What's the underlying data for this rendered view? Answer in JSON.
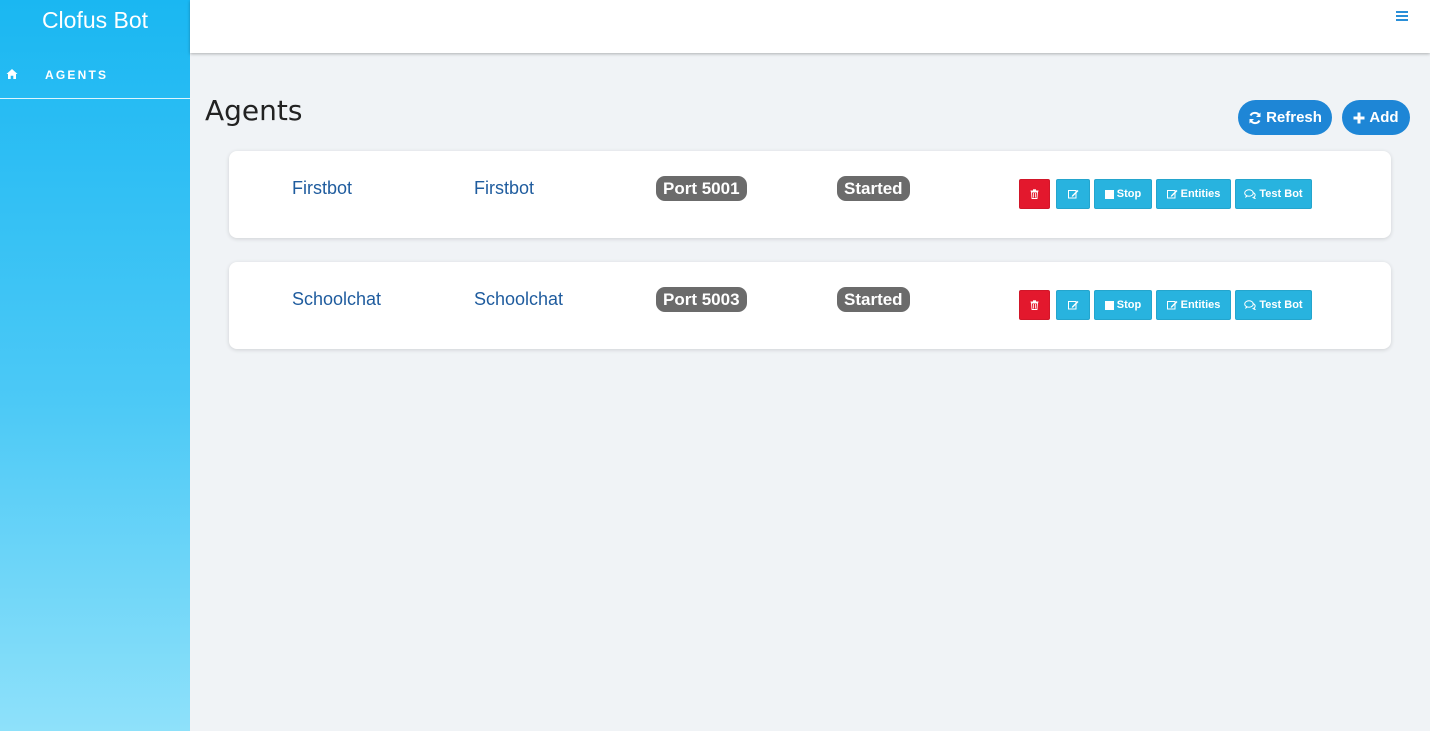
{
  "app": {
    "brand": "Clofus Bot"
  },
  "sidebar": {
    "items": [
      {
        "label": "AGENTS",
        "icon": "home-icon"
      }
    ]
  },
  "header": {
    "menu_icon": "hamburger-icon"
  },
  "main": {
    "title": "Agents",
    "refresh_label": "Refresh",
    "add_label": "Add"
  },
  "agents": [
    {
      "name": "Firstbot",
      "description": "Firstbot",
      "port": "Port 5001",
      "status": "Started"
    },
    {
      "name": "Schoolchat",
      "description": "Schoolchat",
      "port": "Port 5003",
      "status": "Started"
    }
  ],
  "row_actions": {
    "stop_label": "Stop",
    "entities_label": "Entities",
    "test_label": "Test Bot"
  },
  "colors": {
    "sidebar_top": "#1ab7f2",
    "sidebar_bottom": "#8ee1fa",
    "primary_button": "#1e86d6",
    "info_button": "#28b3df",
    "danger_button": "#e3182d",
    "badge": "#6b6b6b",
    "link": "#1f5c9e"
  }
}
